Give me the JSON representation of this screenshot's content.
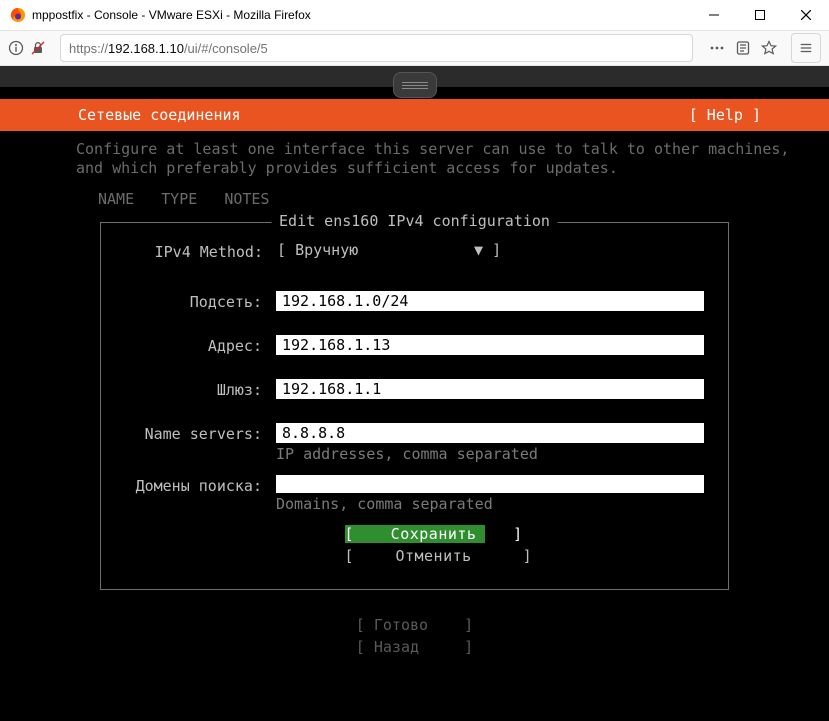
{
  "window": {
    "title": "mppostfix - Console - VMware ESXi - Mozilla Firefox"
  },
  "url": {
    "scheme": "https://",
    "host": "192.168.1.10",
    "path": "/ui/#/console/5"
  },
  "orange_header": {
    "left": "Сетевые соединения",
    "help": "[ Help ]"
  },
  "description": {
    "line1": "Configure at least one interface this server can use to talk to other machines,",
    "line2": "and which preferably provides sufficient access for updates."
  },
  "columns": {
    "name": "NAME",
    "type": "TYPE",
    "notes": "NOTES"
  },
  "form": {
    "title": "Edit ens160 IPv4 configuration",
    "method_label": "IPv4 Method:",
    "method_value": "Вручную",
    "subnet_label": "Подсеть:",
    "subnet_value": "192.168.1.0/24",
    "address_label": "Адрес:",
    "address_value": "192.168.1.13",
    "gateway_label": "Шлюз:",
    "gateway_value": "192.168.1.1",
    "nameservers_label": "Name servers:",
    "nameservers_value": "8.8.8.8",
    "nameservers_hint": "IP addresses, comma separated",
    "searchdomains_label": "Домены поиска:",
    "searchdomains_value": "",
    "searchdomains_hint": "Domains, comma separated",
    "save": "Сохранить",
    "cancel": "Отменить"
  },
  "footer": {
    "done": "Готово",
    "back": "Назад"
  }
}
